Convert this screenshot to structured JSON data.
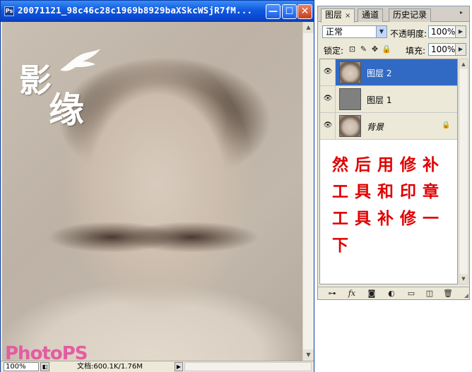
{
  "document": {
    "title": "20071121_98c46c28c1969b8929baXSkcWSjR7fM...",
    "app_icon": "photoshop-doc-icon",
    "window_buttons": {
      "minimize": "—",
      "maximize": "☐",
      "close": "✕"
    },
    "watermark": {
      "chars": [
        "影",
        "缘"
      ],
      "brand": "PhotoPS"
    },
    "status": {
      "zoom": "100%",
      "doc_info": "文档:600.1K/1.76M"
    }
  },
  "layers_panel": {
    "tabs": [
      {
        "label": "图层",
        "close": "×",
        "active": true
      },
      {
        "label": "通道",
        "active": false
      },
      {
        "label": "历史记录",
        "active": false
      }
    ],
    "blend_mode": "正常",
    "opacity_label": "不透明度:",
    "opacity_value": "100%",
    "lock_label": "锁定:",
    "lock_icons": [
      "lock-transparent-icon",
      "lock-brush-icon",
      "lock-move-icon",
      "lock-all-icon"
    ],
    "fill_label": "填充:",
    "fill_value": "100%",
    "layers": [
      {
        "name": "图层 2",
        "thumb": "photo",
        "selected": true,
        "locked": false,
        "italic": false
      },
      {
        "name": "图层 1",
        "thumb": "gray",
        "selected": false,
        "locked": false,
        "italic": false
      },
      {
        "name": "背景",
        "thumb": "photo",
        "selected": false,
        "locked": true,
        "italic": true
      }
    ],
    "footer_icons": [
      "link-icon",
      "fx-icon",
      "mask-icon",
      "adjustment-icon",
      "group-folder-icon",
      "new-layer-icon",
      "trash-icon"
    ]
  },
  "annotation": {
    "color": "#e00000",
    "lines": [
      "然后用修补",
      "工具和印章",
      "工具补修一",
      "下"
    ]
  }
}
